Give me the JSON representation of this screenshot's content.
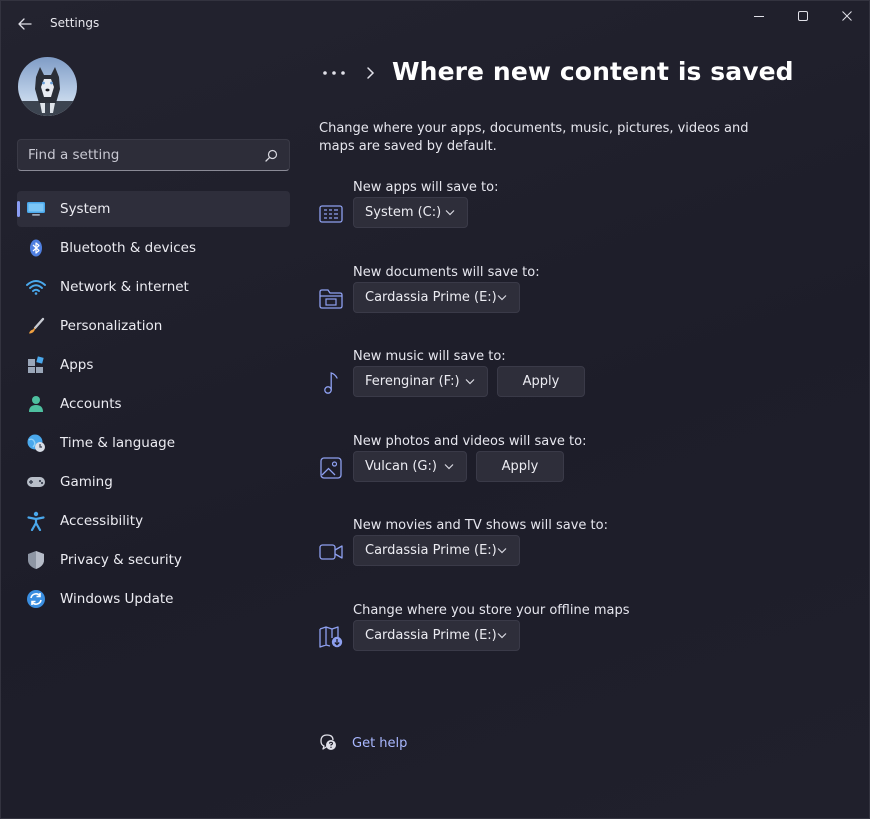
{
  "window": {
    "title": "Settings"
  },
  "search": {
    "placeholder": "Find a setting"
  },
  "sidebar": {
    "items": [
      {
        "label": "System",
        "icon": "system-icon",
        "selected": true
      },
      {
        "label": "Bluetooth & devices",
        "icon": "bluetooth-icon"
      },
      {
        "label": "Network & internet",
        "icon": "wifi-icon"
      },
      {
        "label": "Personalization",
        "icon": "brush-icon"
      },
      {
        "label": "Apps",
        "icon": "apps-icon"
      },
      {
        "label": "Accounts",
        "icon": "person-icon"
      },
      {
        "label": "Time & language",
        "icon": "globe-clock-icon"
      },
      {
        "label": "Gaming",
        "icon": "gamepad-icon"
      },
      {
        "label": "Accessibility",
        "icon": "accessibility-icon"
      },
      {
        "label": "Privacy & security",
        "icon": "shield-icon"
      },
      {
        "label": "Windows Update",
        "icon": "update-icon"
      }
    ]
  },
  "header": {
    "breadcrumb_more": "•••",
    "title": "Where new content is saved"
  },
  "main": {
    "description": "Change where your apps, documents, music, pictures, videos and maps are saved by default.",
    "settings": [
      {
        "label": "New apps will save to:",
        "icon": "apps-storage-icon",
        "value": "System (C:)",
        "apply": null
      },
      {
        "label": "New documents will save to:",
        "icon": "documents-folder-icon",
        "value": "Cardassia Prime (E:)",
        "apply": null
      },
      {
        "label": "New music will save to:",
        "icon": "music-note-icon",
        "value": "Ferenginar (F:)",
        "apply": "Apply"
      },
      {
        "label": "New photos and videos will save to:",
        "icon": "photo-icon",
        "value": "Vulcan (G:)",
        "apply": "Apply"
      },
      {
        "label": "New movies and TV shows will save to:",
        "icon": "video-camera-icon",
        "value": "Cardassia Prime (E:)",
        "apply": null
      },
      {
        "label": "Change where you store your offline maps",
        "icon": "map-download-icon",
        "value": "Cardassia Prime (E:)",
        "apply": null
      }
    ],
    "help_label": "Get help"
  },
  "colors": {
    "accent": "#8a9df4",
    "link": "#a9b8ff",
    "background": "#1e1e2a"
  }
}
